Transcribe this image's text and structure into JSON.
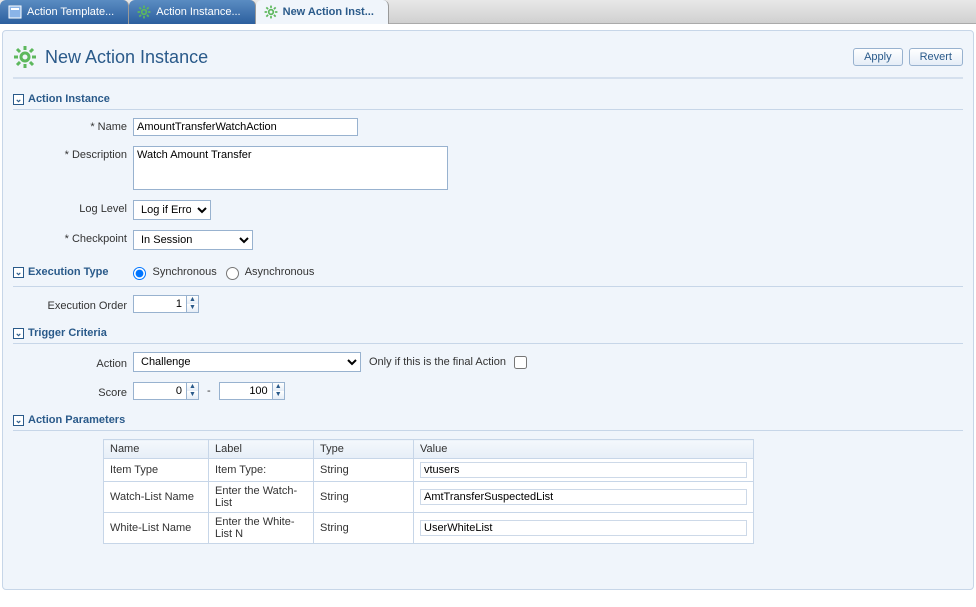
{
  "tabs": [
    {
      "label": "Action Template...",
      "icon": "template"
    },
    {
      "label": "Action Instance...",
      "icon": "gear"
    },
    {
      "label": "New Action Inst...",
      "icon": "gear",
      "active": true
    }
  ],
  "header": {
    "title": "New Action Instance",
    "apply_label": "Apply",
    "revert_label": "Revert"
  },
  "sections": {
    "action_instance": {
      "title": "Action Instance",
      "name_label": "Name",
      "name_value": "AmountTransferWatchAction",
      "description_label": "Description",
      "description_value": "Watch Amount Transfer",
      "loglevel_label": "Log Level",
      "loglevel_value": "Log if Error",
      "checkpoint_label": "Checkpoint",
      "checkpoint_value": "In Session"
    },
    "execution_type": {
      "title": "Execution Type",
      "sync_label": "Synchronous",
      "async_label": "Asynchronous",
      "selected": "sync",
      "order_label": "Execution Order",
      "order_value": "1"
    },
    "trigger_criteria": {
      "title": "Trigger Criteria",
      "action_label": "Action",
      "action_value": "Challenge",
      "final_label": "Only if this is the final Action",
      "final_checked": false,
      "score_label": "Score",
      "score_min": "0",
      "score_max": "100"
    },
    "action_parameters": {
      "title": "Action Parameters",
      "columns": {
        "name": "Name",
        "label": "Label",
        "type": "Type",
        "value": "Value"
      },
      "rows": [
        {
          "name": "Item Type",
          "label": "Item Type:",
          "type": "String",
          "value": "vtusers"
        },
        {
          "name": "Watch-List Name",
          "label": "Enter the Watch-List",
          "type": "String",
          "value": "AmtTransferSuspectedList"
        },
        {
          "name": "White-List Name",
          "label": "Enter the White-List N",
          "type": "String",
          "value": "UserWhiteList"
        }
      ]
    }
  }
}
